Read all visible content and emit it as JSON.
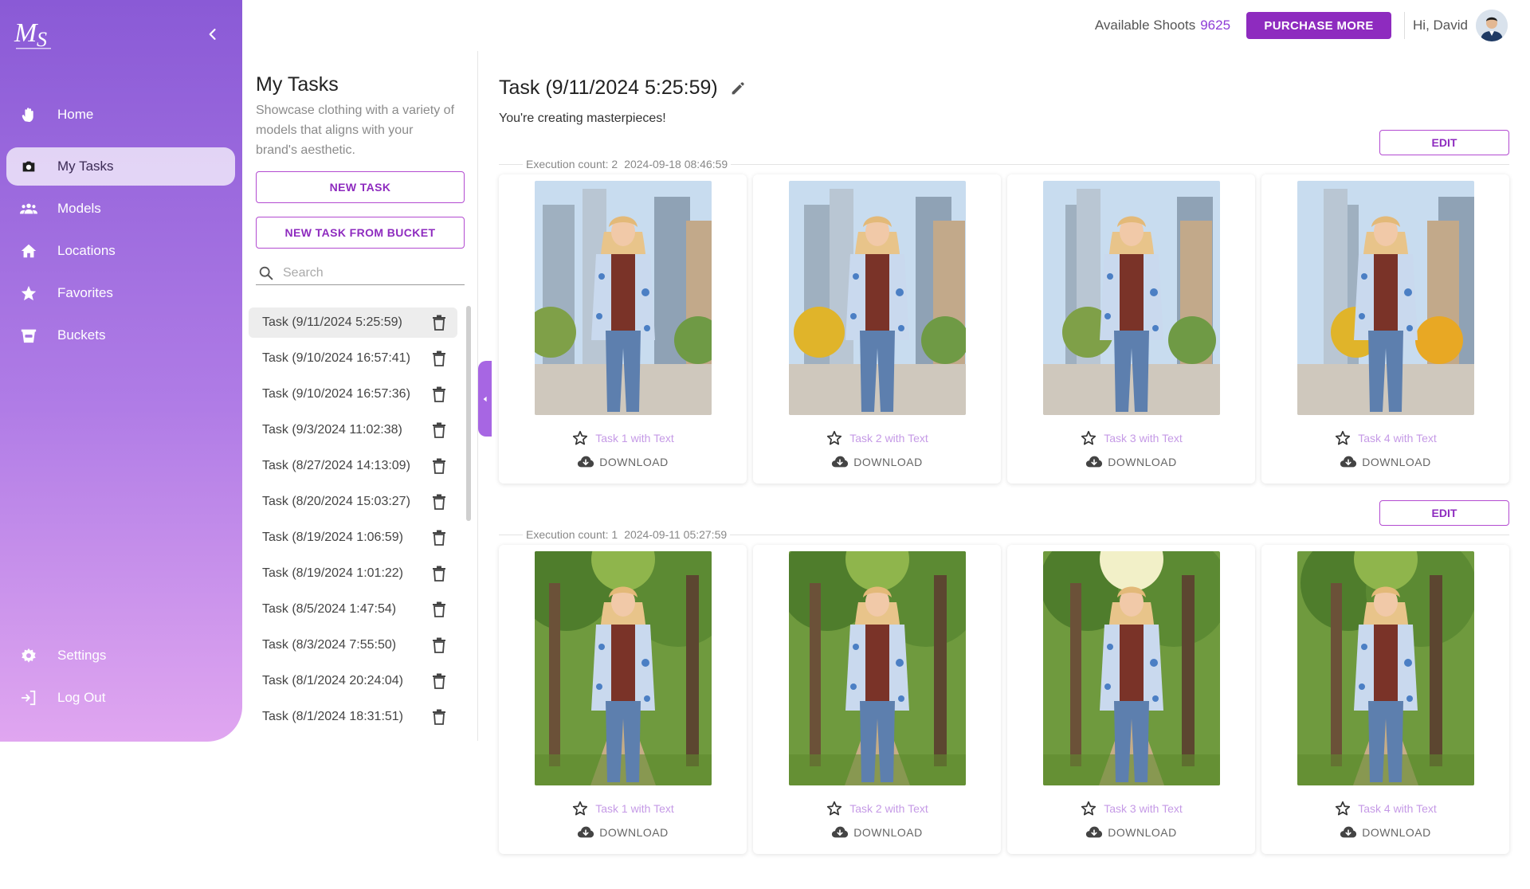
{
  "app": {
    "logo_text": "MS"
  },
  "sidebar": {
    "items": [
      {
        "label": "Home",
        "icon": "waving-hand-icon"
      },
      {
        "label": "My Tasks",
        "icon": "camera-icon",
        "active": true
      },
      {
        "label": "Models",
        "icon": "people-icon"
      },
      {
        "label": "Locations",
        "icon": "home-icon"
      },
      {
        "label": "Favorites",
        "icon": "star-icon"
      },
      {
        "label": "Buckets",
        "icon": "bucket-icon"
      }
    ],
    "bottom_items": [
      {
        "label": "Settings",
        "icon": "gear-icon"
      },
      {
        "label": "Log Out",
        "icon": "logout-icon"
      }
    ]
  },
  "tasks_panel": {
    "title": "My Tasks",
    "description": "Showcase clothing with a variety of models that aligns with your brand's aesthetic.",
    "new_task_label": "NEW TASK",
    "new_task_bucket_label": "NEW TASK FROM BUCKET",
    "search_placeholder": "Search",
    "tasks": [
      "Task (9/11/2024 5:25:59)",
      "Task (9/10/2024 16:57:41)",
      "Task (9/10/2024 16:57:36)",
      "Task (9/3/2024 11:02:38)",
      "Task (8/27/2024 14:13:09)",
      "Task (8/20/2024 15:03:27)",
      "Task (8/19/2024 1:06:59)",
      "Task (8/19/2024 1:01:22)",
      "Task (8/5/2024 1:47:54)",
      "Task (8/3/2024 7:55:50)",
      "Task (8/1/2024 20:24:04)",
      "Task (8/1/2024 18:31:51)"
    ]
  },
  "header": {
    "available_label": "Available Shoots",
    "available_count": "9625",
    "purchase_label": "PURCHASE MORE",
    "greeting": "Hi, David"
  },
  "main": {
    "title": "Task (9/11/2024 5:25:59)",
    "subtitle": "You're creating masterpieces!",
    "edit_label": "EDIT",
    "download_label": "DOWNLOAD",
    "executions": [
      {
        "label": "Execution count: 2",
        "timestamp": "2024-09-18 08:46:59",
        "scene": "city",
        "results": [
          "Task 1 with Text",
          "Task 2 with Text",
          "Task 3 with Text",
          "Task 4 with Text"
        ]
      },
      {
        "label": "Execution count: 1",
        "timestamp": "2024-09-11 05:27:59",
        "scene": "forest",
        "results": [
          "Task 1 with Text",
          "Task 2 with Text",
          "Task 3 with Text",
          "Task 4 with Text"
        ]
      }
    ]
  },
  "colors": {
    "accent": "#8e2bbf",
    "sidebar_top": "#8a5ad6",
    "sidebar_bottom": "#e0a6f0",
    "favorite_text": "#c59ae6"
  }
}
